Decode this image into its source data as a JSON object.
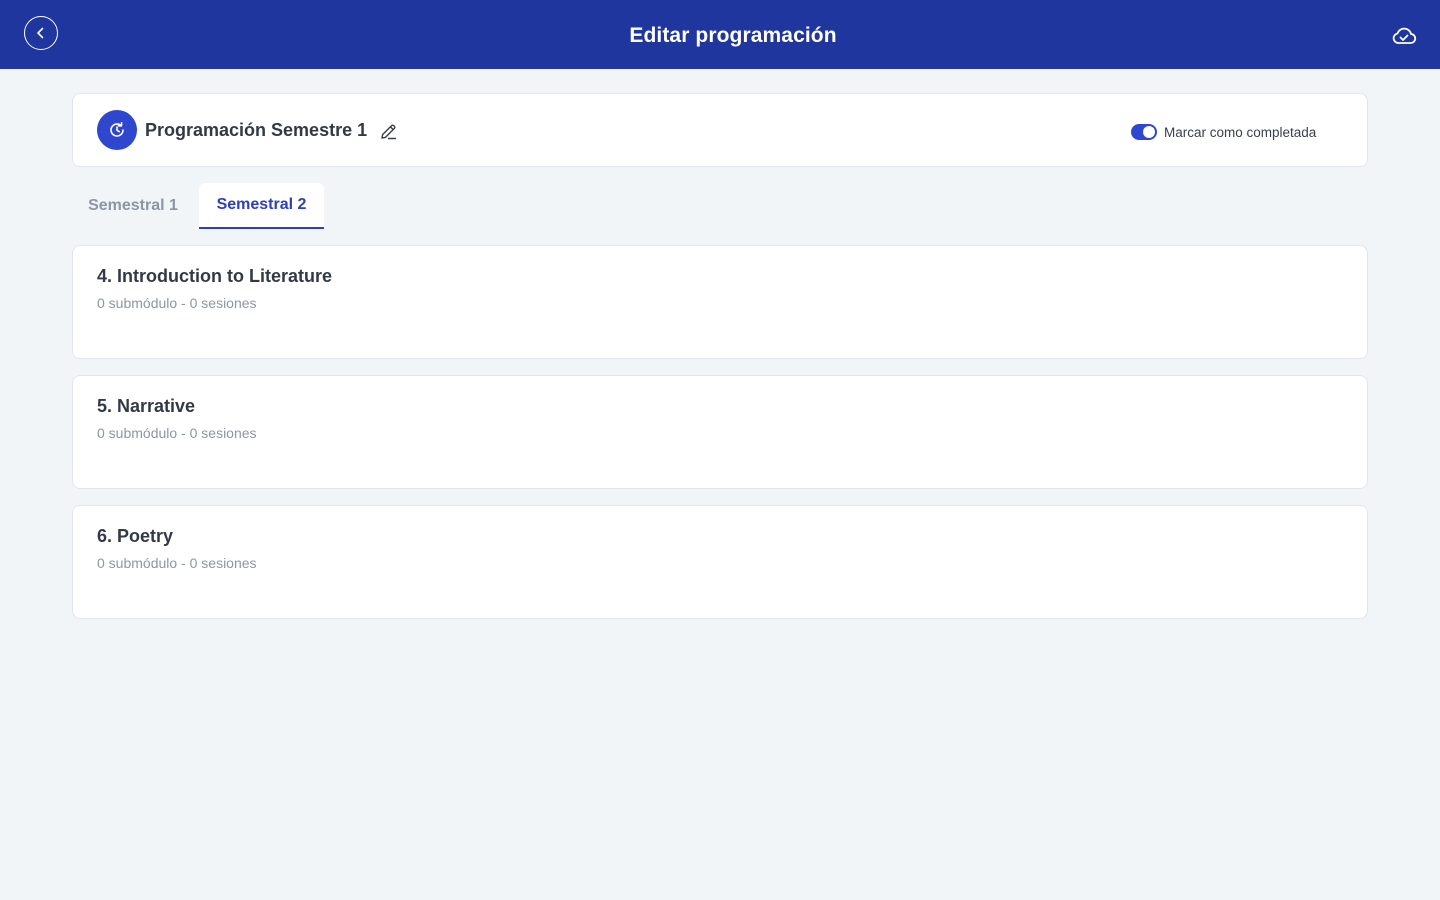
{
  "header": {
    "title": "Editar programación",
    "back_icon": "chevron-left-icon",
    "cloud_icon": "cloud-check-icon"
  },
  "program": {
    "title": "Programación Semestre 1",
    "icon": "refresh-clock-icon",
    "edit_icon": "pencil-icon",
    "complete_toggle": {
      "label": "Marcar como completada",
      "on": true
    }
  },
  "tabs": [
    {
      "label": "Semestral 1",
      "active": false
    },
    {
      "label": "Semestral 2",
      "active": true
    }
  ],
  "modules": [
    {
      "title": "4. Introduction to Literature",
      "meta": "0 submódulo - 0 sesiones"
    },
    {
      "title": "5. Narrative",
      "meta": "0 submódulo - 0 sesiones"
    },
    {
      "title": "6. Poetry",
      "meta": "0 submódulo - 0 sesiones"
    }
  ],
  "colors": {
    "topbar": "#1f369e",
    "accent": "#2f47cf",
    "background": "#f1f5f8",
    "muted_text": "#8d96a5"
  }
}
